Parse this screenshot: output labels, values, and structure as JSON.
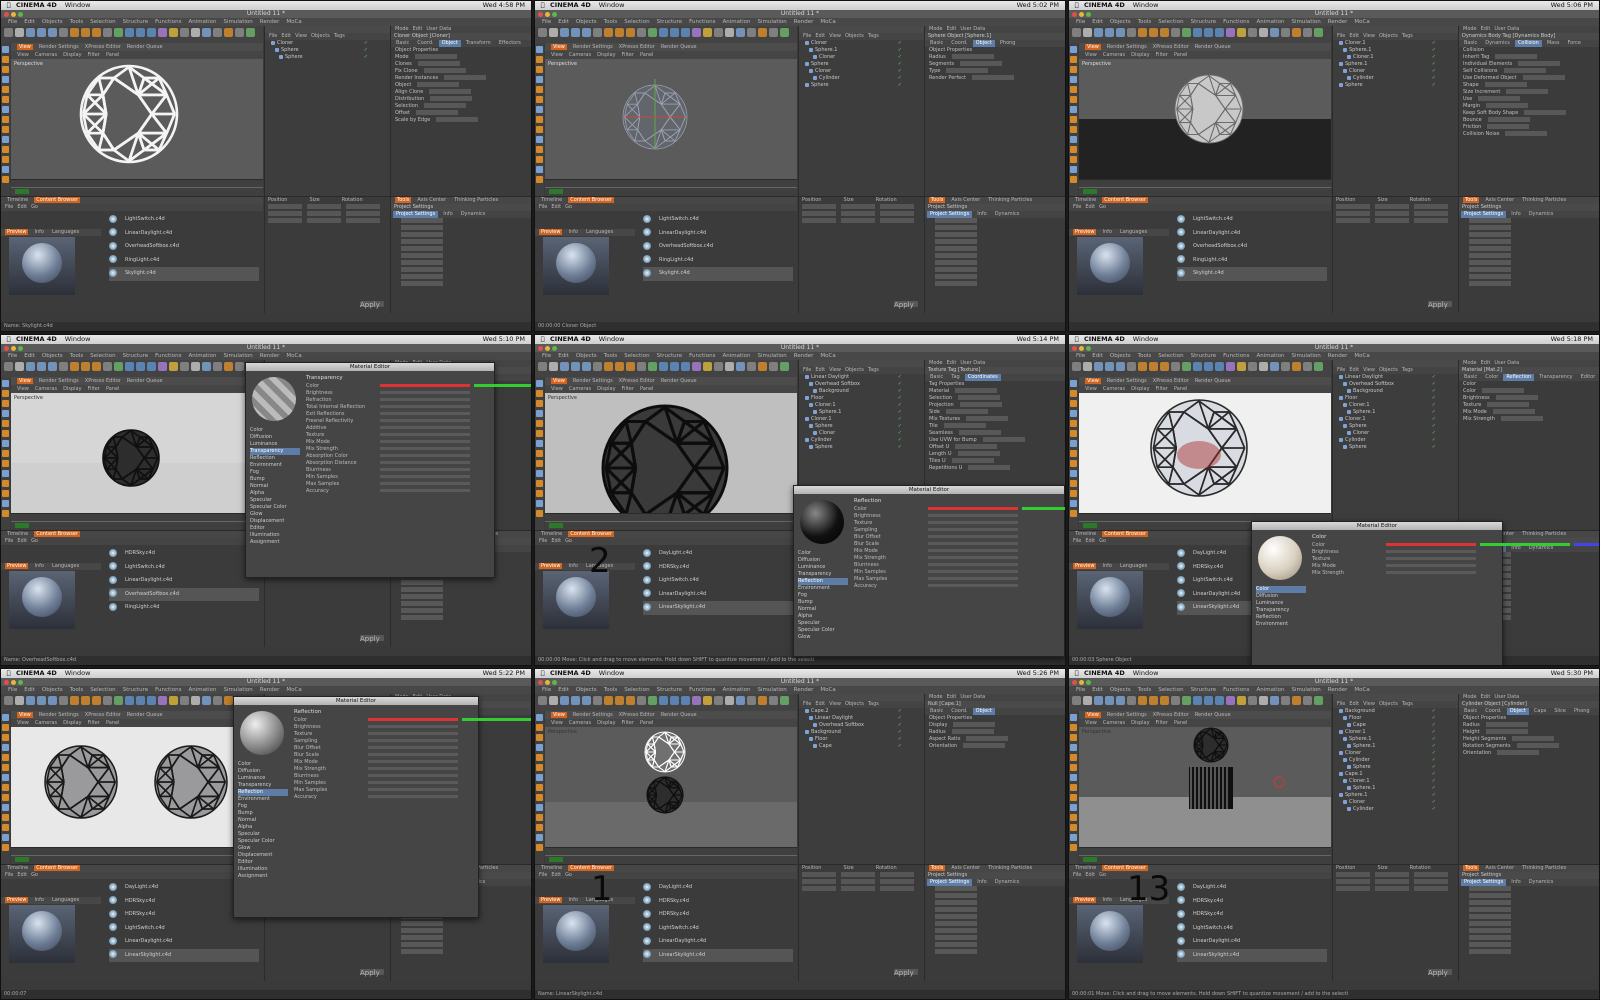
{
  "app": {
    "name": "CINEMA 4D",
    "window_menu": "Window",
    "doc_title": "Untitled 11 *",
    "menu": [
      "File",
      "Edit",
      "Objects",
      "Tools",
      "Selection",
      "Structure",
      "Functions",
      "Animation",
      "Simulation",
      "Render",
      "MoCa"
    ],
    "viewport_menu": [
      "View",
      "Cameras",
      "Display",
      "Filter",
      "Panel"
    ],
    "viewport_tabs": [
      "View",
      "Render Settings",
      "XPresso Editor",
      "Render Queue"
    ],
    "pane_menu": [
      "File",
      "Edit",
      "View",
      "Objects",
      "Tags"
    ],
    "attr_menu": [
      "Mode",
      "Edit",
      "User Data"
    ],
    "cb_tabs": [
      "Timeline",
      "Content Browser"
    ],
    "cb_menu": [
      "File",
      "Edit",
      "Go"
    ],
    "cb_subtabs": [
      "Preview",
      "Info",
      "Languages"
    ],
    "proj_tabs": [
      "Tools",
      "Axis Center",
      "Thinking Particles"
    ],
    "proj_subtabs": [
      "Project Settings",
      "Info",
      "Dynamics"
    ],
    "proj_title": "Project Settings",
    "coord_headers": [
      "Position",
      "Size",
      "Rotation"
    ],
    "coord_buttons": [
      "Object (Rel)",
      "Size",
      "Apply"
    ]
  },
  "frames": [
    {
      "time": "Wed 4:58 PM",
      "objects": [
        "Cloner",
        "Sphere",
        "Sphere"
      ],
      "attr_title": "Cloner Object [Cloner]",
      "attr_tabs": [
        "Basic",
        "Coord.",
        "Object",
        "Transform",
        "Effectors"
      ],
      "attr_rows": [
        "Object Properties",
        "Mode",
        "Clones",
        "Fix Clone",
        "Render Instances",
        "Object",
        "Align Clone",
        "Distribution",
        "Selection",
        "Offset",
        "Scale by Edge"
      ],
      "files": [
        "LightSwitch.c4d",
        "LinearDaylight.c4d",
        "OverheadSoftbox.c4d",
        "RingLight.c4d",
        "Skylight.c4d"
      ],
      "file_sel": 4,
      "status": "Name: Skylight.c4d",
      "label": "Perspective"
    },
    {
      "time": "Wed 5:02 PM",
      "objects": [
        "Cloner",
        "Sphere.1",
        "Cloner",
        "Sphere",
        "Cloner",
        "Cylinder",
        "Sphere"
      ],
      "attr_title": "Sphere Object [Sphere.1]",
      "attr_tabs": [
        "Basic",
        "Coord.",
        "Object",
        "Phong"
      ],
      "attr_rows": [
        "Object Properties",
        "Radius",
        "Segments",
        "Type",
        "Render Perfect"
      ],
      "files": [
        "LightSwitch.c4d",
        "LinearDaylight.c4d",
        "OverheadSoftbox.c4d",
        "RingLight.c4d",
        "Skylight.c4d"
      ],
      "file_sel": 4,
      "status": "00:00:00  Cloner Object",
      "label": "Perspective"
    },
    {
      "time": "Wed 5:06 PM",
      "objects": [
        "Cloner.1",
        "Sphere.1",
        "Cloner.1",
        "Sphere.1",
        "Cloner",
        "Cylinder",
        "Sphere"
      ],
      "attr_title": "Dynamics Body Tag [Dynamics Body]",
      "attr_tabs": [
        "Basic",
        "Dynamics",
        "Collision",
        "Mass",
        "Force"
      ],
      "attr_rows": [
        "Collision",
        "Inherit Tag",
        "Individual Elements",
        "Self Collisions",
        "Use Deformed Object",
        "Shape",
        "Size Increment",
        "Use",
        "Margin",
        "Keep Soft Body Shape",
        "Bounce",
        "Friction",
        "Collision Noise"
      ],
      "files": [
        "LightSwitch.c4d",
        "LinearDaylight.c4d",
        "OverheadSoftbox.c4d",
        "RingLight.c4d",
        "Skylight.c4d"
      ],
      "file_sel": 4,
      "status": "",
      "label": "Perspective"
    },
    {
      "time": "Wed 5:10 PM",
      "objects": [],
      "attr_title": "",
      "attr_tabs": [],
      "attr_rows": [],
      "files": [
        "HDRSky.c4d",
        "LightSwitch.c4d",
        "LinearDaylight.c4d",
        "OverheadSoftbox.c4d",
        "RingLight.c4d"
      ],
      "file_sel": 3,
      "status": "Name: OverheadSoftbox.c4d",
      "label": "Perspective",
      "mated": {
        "title": "Material Editor",
        "section": "Transparency",
        "channels": [
          "Color",
          "Diffusion",
          "Luminance",
          "Transparency",
          "Reflection",
          "Environment",
          "Fog",
          "Bump",
          "Normal",
          "Alpha",
          "Specular",
          "Specular Color",
          "Glow",
          "Displacement",
          "Editor",
          "Illumination",
          "Assignment"
        ],
        "on": 3,
        "rows": [
          "Color",
          "Brightness",
          "Refraction",
          "Total Internal Reflection",
          "Exit Reflections",
          "Fresnel Reflectivity",
          "Additive",
          "Texture",
          "Mix Mode",
          "Mix Strength",
          "Absorption Color",
          "Absorption Distance",
          "Blurriness",
          "Min Samples",
          "Max Samples",
          "Accuracy"
        ]
      }
    },
    {
      "time": "Wed 5:14 PM",
      "objects": [
        "Linear Daylight",
        "Overhead Softbox",
        "Background",
        "Floor",
        "Cloner.1",
        "Sphere.1",
        "Cloner.1",
        "Sphere",
        "Cloner",
        "Cylinder",
        "Sphere"
      ],
      "attr_title": "Texture Tag [Texture]",
      "attr_tabs": [
        "Basic",
        "Tag",
        "Coordinates"
      ],
      "attr_rows": [
        "Tag Properties",
        "Material",
        "Selection",
        "Projection",
        "Side",
        "Mix Textures",
        "Tile",
        "Seamless",
        "Use UVW for Bump",
        "Offset U",
        "Length U",
        "Tiles U",
        "Repetitions U"
      ],
      "files": [
        "DayLight.c4d",
        "HDRSky.c4d",
        "LightSwitch.c4d",
        "LinearDaylight.c4d",
        "LinearSkylight.c4d"
      ],
      "file_sel": 4,
      "status": "00:00:00  Move: Click and drag to move elements. Hold down SHIFT to quantize movement / add to the selecti",
      "label": "Perspective",
      "bignum": "2",
      "mated": {
        "title": "Material Editor",
        "section": "Reflection",
        "channels": [
          "Color",
          "Diffusion",
          "Luminance",
          "Transparency",
          "Reflection",
          "Environment",
          "Fog",
          "Bump",
          "Normal",
          "Alpha",
          "Specular",
          "Specular Color",
          "Glow"
        ],
        "on": 4,
        "rows": [
          "Color",
          "Brightness",
          "Texture",
          "Sampling",
          "Blur Offset",
          "Blur Scale",
          "Mix Mode",
          "Mix Strength",
          "Blurriness",
          "Min Samples",
          "Max Samples",
          "Accuracy"
        ]
      }
    },
    {
      "time": "Wed 5:18 PM",
      "objects": [
        "Linear Daylight",
        "Overhead Softbox",
        "Background",
        "Floor",
        "Cloner.1",
        "Sphere.1",
        "Cloner.1",
        "Sphere",
        "Cloner",
        "Cylinder",
        "Sphere"
      ],
      "attr_title": "Material [Mat.2]",
      "attr_tabs": [
        "Basic",
        "Color",
        "Reflection",
        "Transparency",
        "Editor",
        "Assign"
      ],
      "attr_rows": [
        "Color",
        "Color",
        "Brightness",
        "Texture",
        "Mix Mode",
        "Mix Strength"
      ],
      "files": [
        "DayLight.c4d",
        "HDRSky.c4d",
        "LightSwitch.c4d",
        "LinearDaylight.c4d",
        "LinearSkylight.c4d"
      ],
      "file_sel": 4,
      "status": "00:00:03  Sphere Object",
      "label": "",
      "mated": {
        "title": "Material Editor",
        "section": "Color",
        "channels": [
          "Color",
          "Diffusion",
          "Luminance",
          "Transparency",
          "Reflection",
          "Environment"
        ],
        "on": 0,
        "rows": [
          "Color",
          "Brightness",
          "Texture",
          "Mix Mode",
          "Mix Strength"
        ]
      }
    },
    {
      "time": "Wed 5:22 PM",
      "objects": [],
      "attr_title": "",
      "attr_tabs": [],
      "attr_rows": [],
      "files": [
        "DayLight.c4d",
        "HDRSky.c4d",
        "HDRSky.c4d",
        "LightSwitch.c4d",
        "LinearDaylight.c4d",
        "LinearSkylight.c4d"
      ],
      "file_sel": 5,
      "status": "00:00:07",
      "label": "",
      "mated": {
        "title": "Material Editor",
        "section": "Reflection",
        "channels": [
          "Color",
          "Diffusion",
          "Luminance",
          "Transparency",
          "Reflection",
          "Environment",
          "Fog",
          "Bump",
          "Normal",
          "Alpha",
          "Specular",
          "Specular Color",
          "Glow",
          "Displacement",
          "Editor",
          "Illumination",
          "Assignment"
        ],
        "on": 4,
        "rows": [
          "Color",
          "Brightness",
          "Texture",
          "Sampling",
          "Blur Offset",
          "Blur Scale",
          "Mix Mode",
          "Mix Strength",
          "Blurriness",
          "Min Samples",
          "Max Samples",
          "Accuracy"
        ]
      }
    },
    {
      "time": "Wed 5:26 PM",
      "objects": [
        "Cape.2",
        "Linear Daylight",
        "Overhead Softbox",
        "Background",
        "Floor",
        "Cape"
      ],
      "attr_title": "Null [Cape.1]",
      "attr_tabs": [
        "Basic",
        "Coord.",
        "Object"
      ],
      "attr_rows": [
        "Object Properties",
        "Display",
        "Radius",
        "Aspect Ratio",
        "Orientation"
      ],
      "files": [
        "DayLight.c4d",
        "HDRSky.c4d",
        "HDRSky.c4d",
        "LightSwitch.c4d",
        "LinearDaylight.c4d",
        "LinearSkylight.c4d"
      ],
      "file_sel": 5,
      "status": "Name: LinearSkylight.c4d",
      "label": "Perspective",
      "bignum": "1"
    },
    {
      "time": "Wed 5:30 PM",
      "objects": [
        "Background",
        "Floor",
        "Cape",
        "Cloner.1",
        "Sphere.1",
        "Sphere.1",
        "Cloner",
        "Cylinder",
        "Sphere",
        "Cape.1",
        "Cloner.1",
        "Sphere.1",
        "Sphere.1",
        "Cloner",
        "Cylinder"
      ],
      "attr_title": "Cylinder Object [Cylinder]",
      "attr_tabs": [
        "Basic",
        "Coord.",
        "Object",
        "Caps",
        "Slice",
        "Phong"
      ],
      "attr_rows": [
        "Object Properties",
        "Radius",
        "Height",
        "Height Segments",
        "Rotation Segments",
        "Orientation"
      ],
      "files": [
        "DayLight.c4d",
        "HDRSky.c4d",
        "HDRSky.c4d",
        "LightSwitch.c4d",
        "LinearDaylight.c4d",
        "LinearSkylight.c4d"
      ],
      "file_sel": 5,
      "status": "00:00:01  Move: Click and drag to move elements. Hold down SHIFT to quantize movement / add to the selecti",
      "label": "Perspective",
      "bignum": "13"
    }
  ],
  "colors": {
    "accent_orange": "#d1641e",
    "select_blue": "#5e7da6",
    "panel_bg": "#3a3a3a",
    "viewport_bg": "#5b5b5b"
  }
}
